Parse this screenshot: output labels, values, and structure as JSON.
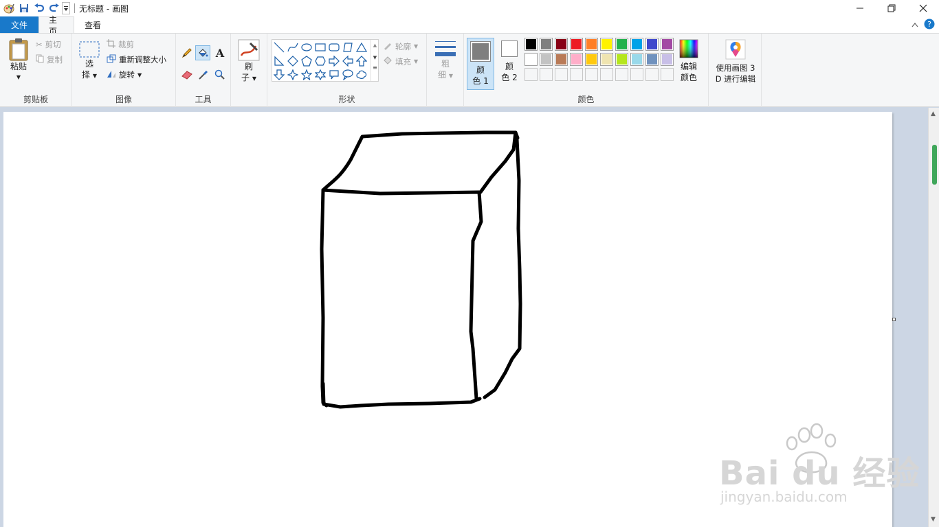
{
  "window": {
    "title": "无标题 - 画图"
  },
  "tabs": {
    "file": "文件",
    "home": "主页",
    "view": "查看"
  },
  "clipboard": {
    "paste": "粘贴",
    "cut": "剪切",
    "copy": "复制",
    "label": "剪贴板"
  },
  "image": {
    "select_line1": "选",
    "select_line2": "择",
    "crop": "裁剪",
    "resize": "重新调整大小",
    "rotate": "旋转",
    "label": "图像"
  },
  "tools": {
    "label": "工具"
  },
  "brushes": {
    "line1": "刷",
    "line2": "子"
  },
  "shapes": {
    "outline": "轮廓",
    "fill": "填充",
    "label": "形状"
  },
  "size": {
    "line1": "粗",
    "line2": "细"
  },
  "colors": {
    "color1_line1": "颜",
    "color1_line2": "色 1",
    "color2_line1": "颜",
    "color2_line2": "色 2",
    "edit_line1": "编辑",
    "edit_line2": "颜色",
    "label": "颜色",
    "color1_value": "#7f7f7f",
    "color2_value": "#ffffff",
    "palette_row1": [
      "#000000",
      "#7f7f7f",
      "#880015",
      "#ed1c24",
      "#ff7f27",
      "#fff200",
      "#22b14c",
      "#00a2e8",
      "#3f48cc",
      "#a349a4"
    ],
    "palette_row2": [
      "#ffffff",
      "#c3c3c3",
      "#b97a57",
      "#ffaec9",
      "#ffc90e",
      "#efe4b0",
      "#b5e61d",
      "#99d9ea",
      "#7092be",
      "#c8bfe7"
    ]
  },
  "paint3d": {
    "line1": "使用画图 3",
    "line2": "D 进行编辑"
  },
  "watermark": {
    "brand": "Bai du 经验",
    "url": "jingyan.baidu.com"
  }
}
